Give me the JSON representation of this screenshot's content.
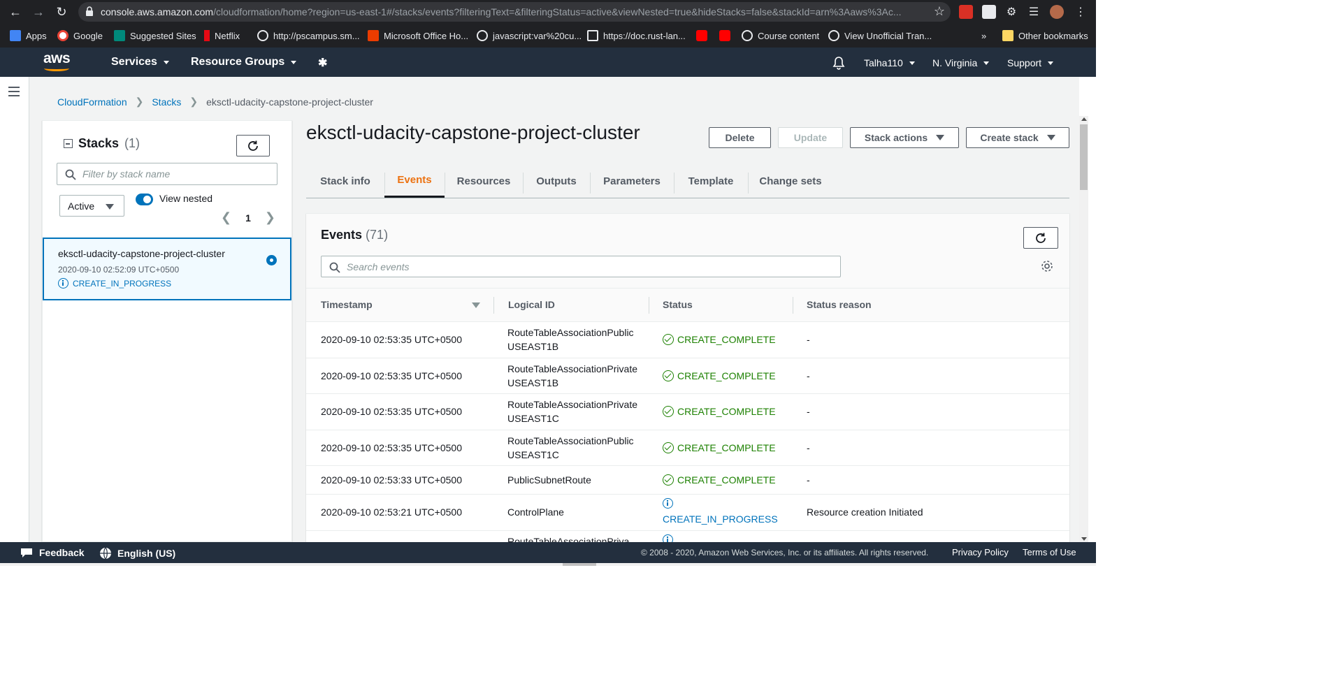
{
  "browser": {
    "url_host": "console.aws.amazon.com",
    "url_path": "/cloudformation/home?region=us-east-1#/stacks/events?filteringText=&filteringStatus=active&viewNested=true&hideStacks=false&stackId=arn%3Aaws%3Ac...",
    "bookmarks": [
      "Apps",
      "Google",
      "Suggested Sites",
      "Netflix",
      "http://pscampus.sm...",
      "Microsoft Office Ho...",
      "javascript:var%20cu...",
      "https://doc.rust-lan...",
      "Course content",
      "View Unofficial Tran..."
    ],
    "more": "»",
    "other_bookmarks": "Other bookmarks"
  },
  "topnav": {
    "logo": "aws",
    "services": "Services",
    "resource_groups": "Resource Groups",
    "user": "Talha110",
    "region": "N. Virginia",
    "support": "Support"
  },
  "breadcrumb": [
    "CloudFormation",
    "Stacks",
    "eksctl-udacity-capstone-project-cluster"
  ],
  "stacks_panel": {
    "title": "Stacks",
    "count": "(1)",
    "filter_placeholder": "Filter by stack name",
    "status_filter": "Active",
    "view_nested": "View nested",
    "page": "1",
    "items": [
      {
        "name": "eksctl-udacity-capstone-project-cluster",
        "time": "2020-09-10 02:52:09 UTC+0500",
        "status": "CREATE_IN_PROGRESS"
      }
    ]
  },
  "detail": {
    "title": "eksctl-udacity-capstone-project-cluster",
    "buttons": {
      "delete": "Delete",
      "update": "Update",
      "stack_actions": "Stack actions",
      "create_stack": "Create stack"
    },
    "tabs": [
      "Stack info",
      "Events",
      "Resources",
      "Outputs",
      "Parameters",
      "Template",
      "Change sets"
    ],
    "active_tab": "Events"
  },
  "events": {
    "title": "Events",
    "count": "(71)",
    "search_placeholder": "Search events",
    "columns": [
      "Timestamp",
      "Logical ID",
      "Status",
      "Status reason"
    ],
    "rows": [
      {
        "timestamp": "2020-09-10 02:53:35 UTC+0500",
        "logical_id": "RouteTableAssociationPublicUSEAST1B",
        "status": "CREATE_COMPLETE",
        "reason": "-"
      },
      {
        "timestamp": "2020-09-10 02:53:35 UTC+0500",
        "logical_id": "RouteTableAssociationPrivateUSEAST1B",
        "status": "CREATE_COMPLETE",
        "reason": "-"
      },
      {
        "timestamp": "2020-09-10 02:53:35 UTC+0500",
        "logical_id": "RouteTableAssociationPrivateUSEAST1C",
        "status": "CREATE_COMPLETE",
        "reason": "-"
      },
      {
        "timestamp": "2020-09-10 02:53:35 UTC+0500",
        "logical_id": "RouteTableAssociationPublicUSEAST1C",
        "status": "CREATE_COMPLETE",
        "reason": "-"
      },
      {
        "timestamp": "2020-09-10 02:53:33 UTC+0500",
        "logical_id": "PublicSubnetRoute",
        "status": "CREATE_COMPLETE",
        "reason": "-"
      },
      {
        "timestamp": "2020-09-10 02:53:21 UTC+0500",
        "logical_id": "ControlPlane",
        "status": "CREATE_IN_PROGRESS",
        "reason": "Resource creation Initiated"
      },
      {
        "timestamp": "",
        "logical_id": "RouteTableAssociationPriva",
        "status": "",
        "reason": ""
      }
    ]
  },
  "footer": {
    "feedback": "Feedback",
    "language": "English (US)",
    "copyright": "© 2008 - 2020, Amazon Web Services, Inc. or its affiliates. All rights reserved.",
    "privacy": "Privacy Policy",
    "terms": "Terms of Use"
  },
  "colors": {
    "aws_nav": "#232f3e",
    "accent_orange": "#ec7211",
    "link_blue": "#0073bb",
    "success_green": "#1d8102"
  }
}
